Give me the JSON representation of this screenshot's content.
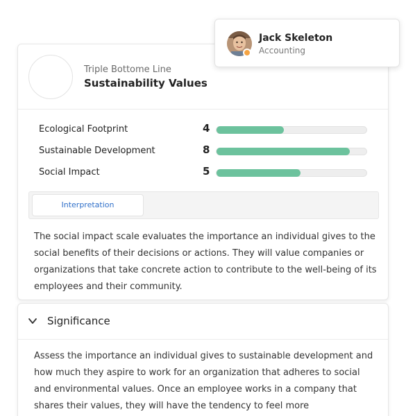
{
  "header": {
    "subtitle": "Triple Bottome Line",
    "title": "Sustainability Values"
  },
  "metrics": [
    {
      "name": "Ecological Footprint",
      "score": "4",
      "level": 0.45
    },
    {
      "name": "Sustainable Development",
      "score": "8",
      "level": 0.89
    },
    {
      "name": "Social Impact",
      "score": "5",
      "level": 0.56
    }
  ],
  "tabs": [
    {
      "label": "Interpretation",
      "active": true
    }
  ],
  "interpretation": {
    "text": "The social impact scale evaluates the importance an individual gives to the social benefits of their decisions or actions. They will value companies or organizations that take concrete action to contribute to the well-being of its employees and their community."
  },
  "significance": {
    "title": "Significance",
    "text": "Assess the importance an individual gives to sustainable development and how much they aspire to work for an organization that adheres to social and environmental values. Once an employee works in a company that shares their values, they will have the tendency to feel more"
  },
  "user": {
    "name": "Jack Skeleton",
    "department": "Accounting",
    "status_color": "#f5a443"
  },
  "colors": {
    "bar_fill": "#6cc29d",
    "tab_text": "#2f6fc9"
  }
}
